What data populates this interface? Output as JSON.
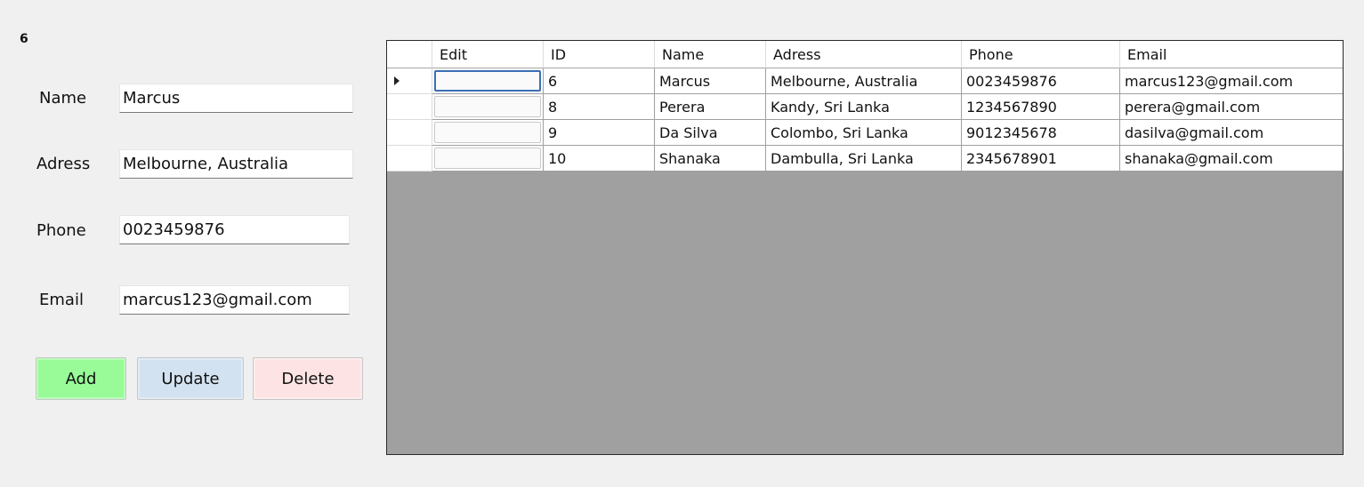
{
  "selected_id": "6",
  "form": {
    "name_label": "Name",
    "name_value": "Marcus",
    "address_label": "Adress",
    "address_value": "Melbourne, Australia",
    "phone_label": "Phone",
    "phone_value": "0023459876",
    "email_label": "Email",
    "email_value": "marcus123@gmail.com"
  },
  "buttons": {
    "add": "Add",
    "update": "Update",
    "delete": "Delete"
  },
  "colors": {
    "add": "#98fb98",
    "update": "#d3e2f0",
    "delete": "#fde3e3",
    "grid_background": "#a0a0a0",
    "selection_border": "#3b6fb4"
  },
  "table": {
    "columns": [
      "Edit",
      "ID",
      "Name",
      "Adress",
      "Phone",
      "Email"
    ],
    "rows": [
      {
        "id": "6",
        "name": "Marcus",
        "address": "Melbourne, Australia",
        "phone": "0023459876",
        "email": "marcus123@gmail.com"
      },
      {
        "id": "8",
        "name": "Perera",
        "address": "Kandy, Sri Lanka",
        "phone": "1234567890",
        "email": "perera@gmail.com"
      },
      {
        "id": "9",
        "name": "Da Silva",
        "address": "Colombo, Sri Lanka",
        "phone": "9012345678",
        "email": "dasilva@gmail.com"
      },
      {
        "id": "10",
        "name": "Shanaka",
        "address": "Dambulla, Sri Lanka",
        "phone": "2345678901",
        "email": "shanaka@gmail.com"
      }
    ],
    "current_row_icon": "triangle-right-icon"
  }
}
